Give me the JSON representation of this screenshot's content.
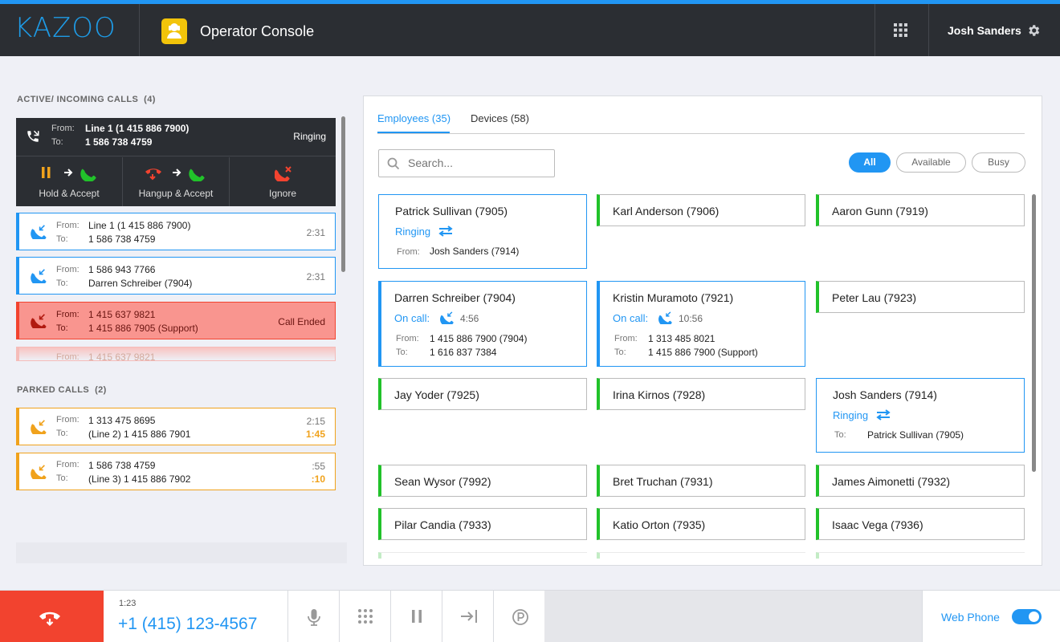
{
  "header": {
    "logo": "KAZOO",
    "title": "Operator Console",
    "user": "Josh Sanders"
  },
  "calls": {
    "active_heading": "ACTIVE/ INCOMING CALLS",
    "active_count": "(4)",
    "current": {
      "from_label": "From:",
      "to_label": "To:",
      "from": "Line 1 (1 415 886 7900)",
      "to": "1 586 738 4759",
      "status": "Ringing",
      "actions": [
        "Hold & Accept",
        "Hangup & Accept",
        "Ignore"
      ]
    },
    "list": [
      {
        "from": "Line 1 (1 415 886 7900)",
        "to": "1 586 738 4759",
        "time": "2:31"
      },
      {
        "from": "1 586 943 7766",
        "to": "Darren Schreiber (7904)",
        "time": "2:31"
      },
      {
        "from": "1 415 637 9821",
        "to": "1 415 886 7905 (Support)",
        "status": "Call Ended"
      },
      {
        "from": "1 415 637 9821"
      }
    ],
    "parked_heading": "PARKED CALLS",
    "parked_count": "(2)",
    "parked": [
      {
        "from": "1 313 475 8695",
        "to": "(Line 2) 1 415 886 7901",
        "time": "2:15",
        "park_time": "1:45"
      },
      {
        "from": "1 586 738 4759",
        "to": "(Line 3) 1 415 886 7902",
        "time": ":55",
        "park_time": ":10"
      }
    ]
  },
  "directory": {
    "tabs": [
      {
        "label": "Employees (35)",
        "active": true
      },
      {
        "label": "Devices (58)",
        "active": false
      }
    ],
    "search_placeholder": "Search...",
    "filters": [
      "All",
      "Available",
      "Busy"
    ],
    "employees": [
      {
        "name": "Patrick Sullivan (7905)",
        "status": "Ringing",
        "from_label": "From:",
        "from": "Josh Sanders (7914)"
      },
      {
        "name": "Karl Anderson (7906)"
      },
      {
        "name": "Aaron Gunn (7919)"
      },
      {
        "name": "Darren Schreiber (7904)",
        "status": "On call:",
        "duration": "4:56",
        "from": "1 415 886 7900 (7904)",
        "to": "1 616 837 7384"
      },
      {
        "name": "Kristin Muramoto (7921)",
        "status": "On call:",
        "duration": "10:56",
        "from": "1 313 485 8021",
        "to": "1 415 886 7900 (Support)"
      },
      {
        "name": "Peter Lau (7923)"
      },
      {
        "name": "Jay Yoder (7925)"
      },
      {
        "name": "Irina Kirnos (7928)"
      },
      {
        "name": "Josh Sanders (7914)",
        "status": "Ringing",
        "to_label": "To:",
        "to": "Patrick Sullivan (7905)"
      },
      {
        "name": "Sean Wysor (7992)"
      },
      {
        "name": "Bret Truchan (7931)"
      },
      {
        "name": "James Aimonetti (7932)"
      },
      {
        "name": "Pilar Candia (7933)"
      },
      {
        "name": "Katio Orton (7935)"
      },
      {
        "name": "Isaac Vega (7936)"
      }
    ]
  },
  "footer": {
    "duration": "1:23",
    "number": "+1 (415) 123-4567",
    "web_phone": "Web Phone",
    "web_phone_on": true
  },
  "colors": {
    "accent": "#2196f3",
    "available": "#21c22a",
    "parked": "#f0a21c",
    "ended": "#f9958f",
    "hangup": "#f2432f",
    "topbar": "#2b2e33"
  }
}
